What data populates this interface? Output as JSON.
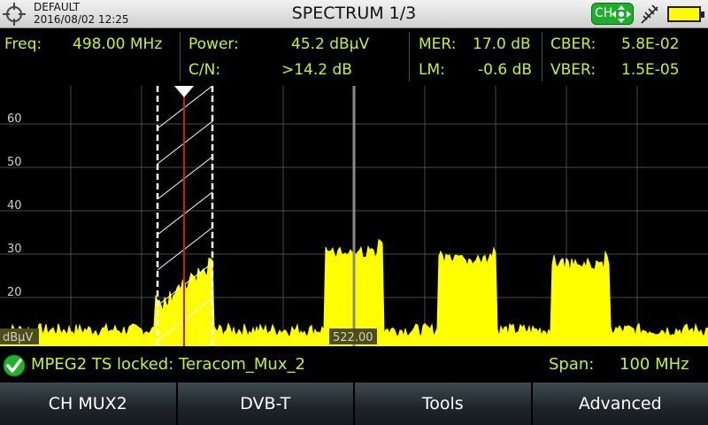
{
  "header": {
    "profile": "DEFAULT",
    "datetime": "2016/08/02 12:25",
    "title": "SPECTRUM 1/3",
    "ch_badge": "CH",
    "icons": [
      "target-icon",
      "move-arrows-icon",
      "antenna-icon",
      "battery-icon"
    ]
  },
  "measurements": {
    "freq_label": "Freq:",
    "freq_value": "498.00 MHz",
    "power_label": "Power:",
    "power_value": "45.2 dBµV",
    "cn_label": "C/N:",
    "cn_value": ">14.2 dB",
    "mer_label": "MER:",
    "mer_value": "17.0 dB",
    "lm_label": "LM:",
    "lm_value": "-0.6 dB",
    "cber_label": "CBER:",
    "cber_value": "5.8E-02",
    "vber_label": "VBER:",
    "vber_value": "1.5E-05"
  },
  "plot": {
    "y_ticks": [
      "60",
      "50",
      "40",
      "30",
      "20"
    ],
    "y_unit": "dBµV",
    "center_freq_label": "522.00",
    "colors": {
      "trace": "#ffff00",
      "grid": "#4a4a4a",
      "marker": "#cc1a1a",
      "center_line": "#8a8a8a"
    }
  },
  "chart_data": {
    "type": "area",
    "ylabel": "dBµV",
    "yticks": [
      20,
      30,
      40,
      50,
      60
    ],
    "center_frequency": 522.0,
    "span_mhz": 100,
    "marker_frequency": 498.0,
    "x": [
      472,
      480,
      488,
      498,
      506,
      514,
      522,
      530,
      538,
      546,
      554,
      562,
      570
    ],
    "y": [
      13,
      12.5,
      12.5,
      26,
      13,
      12.5,
      32,
      12.5,
      30,
      12.5,
      29,
      12.5,
      12.5
    ]
  },
  "status": {
    "lock_text": "MPEG2 TS locked: Teracom_Mux_2",
    "span_label": "Span:",
    "span_value": "100 MHz"
  },
  "softkeys": [
    "CH MUX2",
    "DVB-T",
    "Tools",
    "Advanced"
  ]
}
